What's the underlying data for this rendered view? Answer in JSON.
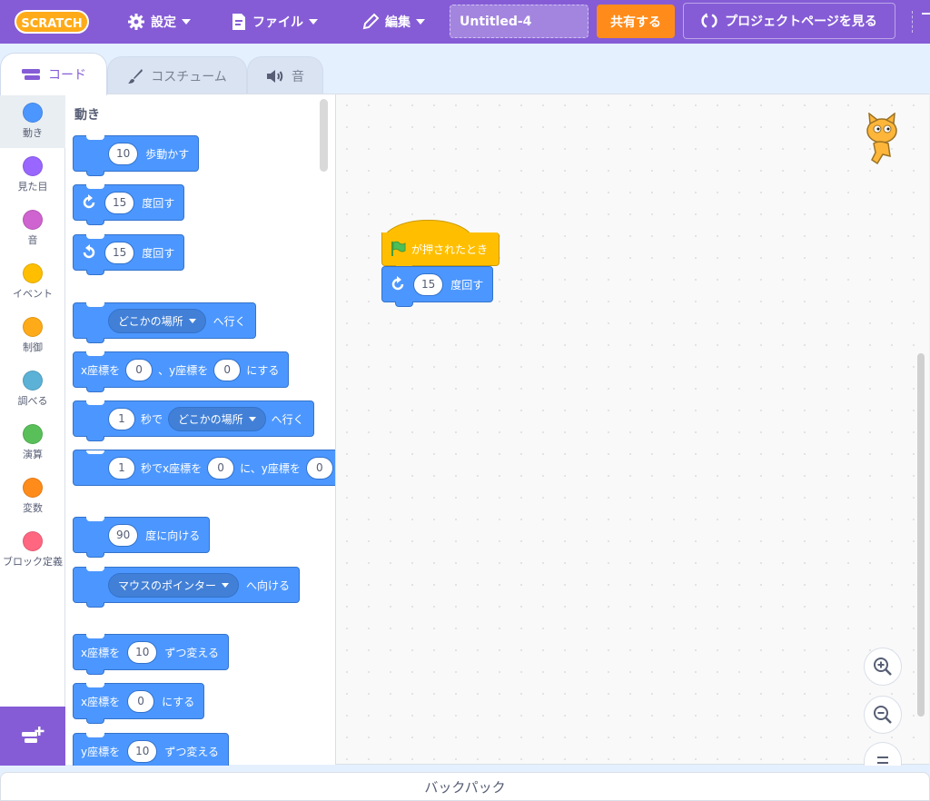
{
  "menubar": {
    "logo_text": "SCRATCH",
    "settings": "設定",
    "file": "ファイル",
    "edit": "編集",
    "project_title": "Untitled-4",
    "share": "共有する",
    "project_page": "プロジェクトページを見る",
    "accent_color": "#855cd6",
    "share_color": "#ff8c1a"
  },
  "tabs": [
    {
      "label": "コード",
      "icon": "code-icon",
      "active": true
    },
    {
      "label": "コスチューム",
      "icon": "paintbrush-icon",
      "active": false
    },
    {
      "label": "音",
      "icon": "speaker-icon",
      "active": false
    }
  ],
  "categories": [
    {
      "label": "動き",
      "color": "#4c97ff"
    },
    {
      "label": "見た目",
      "color": "#9966ff"
    },
    {
      "label": "音",
      "color": "#cf63cf"
    },
    {
      "label": "イベント",
      "color": "#ffbf00"
    },
    {
      "label": "制御",
      "color": "#ffab19"
    },
    {
      "label": "調べる",
      "color": "#5cb1d6"
    },
    {
      "label": "演算",
      "color": "#59c059"
    },
    {
      "label": "変数",
      "color": "#ff8c1a"
    },
    {
      "label": "ブロック定義",
      "color": "#ff6680"
    }
  ],
  "palette": {
    "title": "動き",
    "blocks": {
      "move": {
        "value": "10",
        "text": "歩動かす"
      },
      "turn_right": {
        "value": "15",
        "text": "度回す"
      },
      "turn_left": {
        "value": "15",
        "text": "度回す"
      },
      "goto": {
        "menu": "どこかの場所",
        "text": "へ行く"
      },
      "goto_xy": {
        "t1": "x座標を",
        "x": "0",
        "t2": "、y座標を",
        "y": "0",
        "t3": "にする"
      },
      "glide": {
        "secs": "1",
        "t1": "秒で",
        "menu": "どこかの場所",
        "t2": "へ行く"
      },
      "glide_xy": {
        "secs": "1",
        "t1": "秒でx座標を",
        "x": "0",
        "t2": "に、y座標を",
        "y": "0"
      },
      "point_dir": {
        "value": "90",
        "text": "度に向ける"
      },
      "point_towards": {
        "menu": "マウスのポインター",
        "text": "へ向ける"
      },
      "change_x": {
        "t1": "x座標を",
        "value": "10",
        "t2": "ずつ変える"
      },
      "set_x": {
        "t1": "x座標を",
        "value": "0",
        "t2": "にする"
      },
      "change_y": {
        "t1": "y座標を",
        "value": "10",
        "t2": "ずつ変える"
      }
    }
  },
  "workspace": {
    "hat_text": "が押されたとき",
    "turn_value": "15",
    "turn_text": "度回す"
  },
  "backpack": "バックパック"
}
